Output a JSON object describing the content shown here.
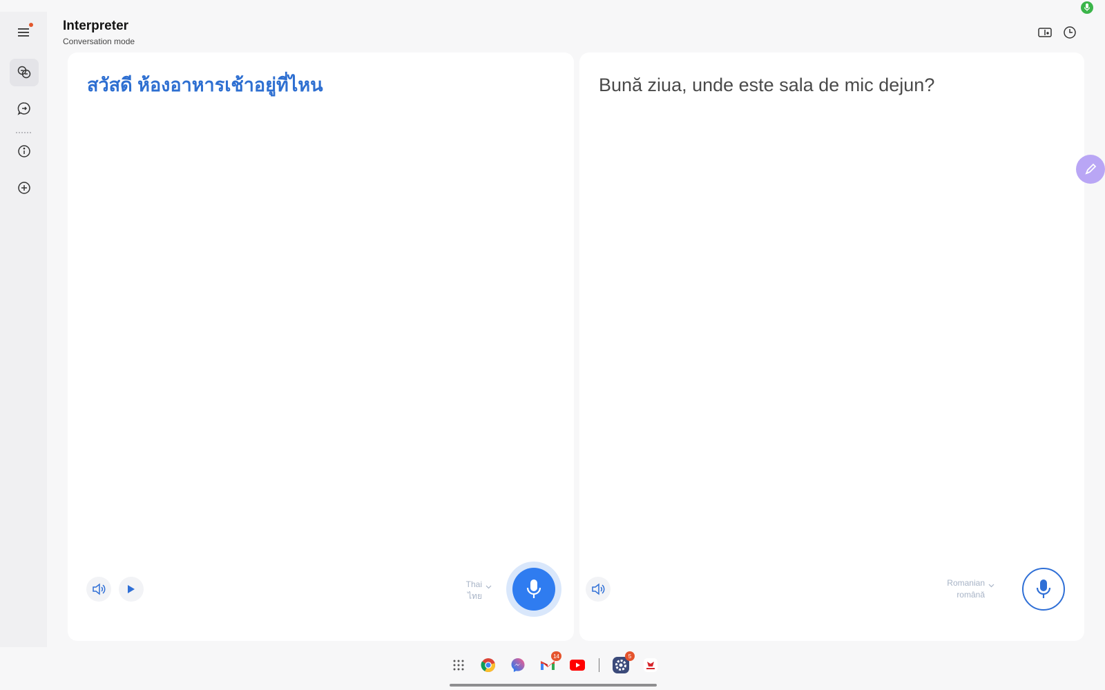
{
  "app": {
    "title": "Interpreter",
    "subtitle": "Conversation mode"
  },
  "rail": {
    "items": [
      {
        "name": "conversation-mode",
        "icon": "conversation-icon",
        "active": true
      },
      {
        "name": "history-chat",
        "icon": "chat-arrow-icon",
        "active": false
      },
      {
        "name": "info",
        "icon": "info-icon",
        "active": false
      },
      {
        "name": "add",
        "icon": "add-circle-icon",
        "active": false
      }
    ]
  },
  "panels": {
    "left": {
      "text": "สวัสดี ห้องอาหารเช้าอยู่ที่ไหน",
      "language": "Thai",
      "language_native": "ไทย"
    },
    "right": {
      "text": "Bună ziua, unde este sala de mic dejun?",
      "language": "Romanian",
      "language_native": "română"
    }
  },
  "taskbar": {
    "apps": [
      {
        "name": "app-drawer",
        "icon": "grid-icon"
      },
      {
        "name": "chrome",
        "icon": "chrome-icon"
      },
      {
        "name": "messenger",
        "icon": "messenger-icon"
      },
      {
        "name": "gmail",
        "icon": "gmail-icon",
        "badge": "14"
      },
      {
        "name": "youtube",
        "icon": "youtube-icon"
      },
      {
        "name": "settings",
        "icon": "settings-icon",
        "badge": "5"
      },
      {
        "name": "samsung-app",
        "icon": "app-icon"
      }
    ]
  },
  "colors": {
    "accent": "#2f7cf0",
    "source_text": "#2e6fd1",
    "target_text": "#4a4a4a",
    "background": "#f7f7f8"
  }
}
